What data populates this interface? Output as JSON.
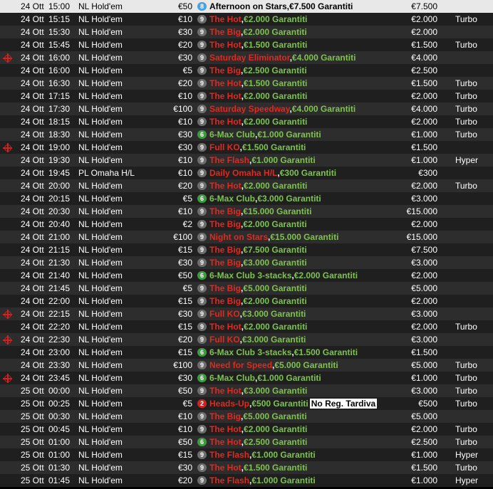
{
  "rows": [
    {
      "date": "24 Ott",
      "time": "15:00",
      "game": "NL Hold'em",
      "buyin": "€50",
      "badge": "8",
      "badge_color": "blue",
      "name_main": "Afternoon on Stars",
      "name_main_color": "black",
      "name_sep": ",",
      "name_rest": "€7.500 Garantiti",
      "name_rest_color": "black",
      "prize": "€7.500",
      "speed": "",
      "pk": false,
      "featured": true
    },
    {
      "date": "24 Ott",
      "time": "15:15",
      "game": "NL Hold'em",
      "buyin": "€10",
      "badge": "9",
      "badge_color": "gray",
      "name_main": "The Hot",
      "name_main_color": "red",
      "name_sep": ",",
      "name_rest": "€2.000 Garantiti",
      "name_rest_color": "green",
      "prize": "€2.000",
      "speed": "Turbo",
      "pk": false
    },
    {
      "date": "24 Ott",
      "time": "15:30",
      "game": "NL Hold'em",
      "buyin": "€30",
      "badge": "9",
      "badge_color": "gray",
      "name_main": "The Big",
      "name_main_color": "red",
      "name_sep": ",",
      "name_rest": "€2.000 Garantiti",
      "name_rest_color": "green",
      "prize": "€2.000",
      "speed": "",
      "pk": false
    },
    {
      "date": "24 Ott",
      "time": "15:45",
      "game": "NL Hold'em",
      "buyin": "€20",
      "badge": "9",
      "badge_color": "gray",
      "name_main": "The Hot",
      "name_main_color": "red",
      "name_sep": ",",
      "name_rest": "€1.500 Garantiti",
      "name_rest_color": "green",
      "prize": "€1.500",
      "speed": "Turbo",
      "pk": false
    },
    {
      "date": "24 Ott",
      "time": "16:00",
      "game": "NL Hold'em",
      "buyin": "€30",
      "badge": "9",
      "badge_color": "gray",
      "name_main": "Saturday Eliminator",
      "name_main_color": "red",
      "name_sep": ",",
      "name_rest": "€4.000 Garantiti",
      "name_rest_color": "green",
      "prize": "€4.000",
      "speed": "",
      "pk": true
    },
    {
      "date": "24 Ott",
      "time": "16:00",
      "game": "NL Hold'em",
      "buyin": "€5",
      "badge": "9",
      "badge_color": "gray",
      "name_main": "The Big",
      "name_main_color": "red",
      "name_sep": ",",
      "name_rest": "€2.500 Garantiti",
      "name_rest_color": "green",
      "prize": "€2.500",
      "speed": "",
      "pk": false
    },
    {
      "date": "24 Ott",
      "time": "16:30",
      "game": "NL Hold'em",
      "buyin": "€20",
      "badge": "9",
      "badge_color": "gray",
      "name_main": "The Hot",
      "name_main_color": "red",
      "name_sep": ",",
      "name_rest": "€1.500 Garantiti",
      "name_rest_color": "green",
      "prize": "€1.500",
      "speed": "Turbo",
      "pk": false
    },
    {
      "date": "24 Ott",
      "time": "17:15",
      "game": "NL Hold'em",
      "buyin": "€10",
      "badge": "9",
      "badge_color": "gray",
      "name_main": "The Hot",
      "name_main_color": "red",
      "name_sep": ",",
      "name_rest": "€2.000 Garantiti",
      "name_rest_color": "green",
      "prize": "€2.000",
      "speed": "Turbo",
      "pk": false
    },
    {
      "date": "24 Ott",
      "time": "17:30",
      "game": "NL Hold'em",
      "buyin": "€100",
      "badge": "9",
      "badge_color": "gray",
      "name_main": "Saturday Speedway",
      "name_main_color": "red",
      "name_sep": ",",
      "name_rest": "€4.000 Garantiti",
      "name_rest_color": "green",
      "prize": "€4.000",
      "speed": "Turbo",
      "pk": false
    },
    {
      "date": "24 Ott",
      "time": "18:15",
      "game": "NL Hold'em",
      "buyin": "€10",
      "badge": "9",
      "badge_color": "gray",
      "name_main": "The Hot",
      "name_main_color": "red",
      "name_sep": ",",
      "name_rest": "€2.000 Garantiti",
      "name_rest_color": "green",
      "prize": "€2.000",
      "speed": "Turbo",
      "pk": false
    },
    {
      "date": "24 Ott",
      "time": "18:30",
      "game": "NL Hold'em",
      "buyin": "€30",
      "badge": "6",
      "badge_color": "green",
      "name_main": "6-Max Club",
      "name_main_color": "green",
      "name_sep": ",",
      "name_rest": "€1.000 Garantiti",
      "name_rest_color": "green",
      "prize": "€1.000",
      "speed": "Turbo",
      "pk": false
    },
    {
      "date": "24 Ott",
      "time": "19:00",
      "game": "NL Hold'em",
      "buyin": "€30",
      "badge": "9",
      "badge_color": "gray",
      "name_main": "Full KO",
      "name_main_color": "red",
      "name_sep": ",",
      "name_rest": "€1.500 Garantiti",
      "name_rest_color": "green",
      "prize": "€1.500",
      "speed": "",
      "pk": true
    },
    {
      "date": "24 Ott",
      "time": "19:30",
      "game": "NL Hold'em",
      "buyin": "€10",
      "badge": "9",
      "badge_color": "gray",
      "name_main": "The Flash",
      "name_main_color": "red",
      "name_sep": ",",
      "name_rest": "€1.000 Garantiti",
      "name_rest_color": "green",
      "prize": "€1.000",
      "speed": "Hyper",
      "pk": false
    },
    {
      "date": "24 Ott",
      "time": "19:45",
      "game": "PL Omaha H/L",
      "buyin": "€10",
      "badge": "9",
      "badge_color": "gray",
      "name_main": "Daily Omaha H/L",
      "name_main_color": "red",
      "name_sep": ",",
      "name_rest": "€300 Garantiti",
      "name_rest_color": "green",
      "prize": "€300",
      "speed": "",
      "pk": false
    },
    {
      "date": "24 Ott",
      "time": "20:00",
      "game": "NL Hold'em",
      "buyin": "€20",
      "badge": "9",
      "badge_color": "gray",
      "name_main": "The Hot",
      "name_main_color": "red",
      "name_sep": ",",
      "name_rest": "€2.000 Garantiti",
      "name_rest_color": "green",
      "prize": "€2.000",
      "speed": "Turbo",
      "pk": false
    },
    {
      "date": "24 Ott",
      "time": "20:15",
      "game": "NL Hold'em",
      "buyin": "€5",
      "badge": "6",
      "badge_color": "green",
      "name_main": "6-Max Club",
      "name_main_color": "green",
      "name_sep": ",",
      "name_rest": "€3.000 Garantiti",
      "name_rest_color": "green",
      "prize": "€3.000",
      "speed": "",
      "pk": false
    },
    {
      "date": "24 Ott",
      "time": "20:30",
      "game": "NL Hold'em",
      "buyin": "€10",
      "badge": "9",
      "badge_color": "gray",
      "name_main": "The Big",
      "name_main_color": "red",
      "name_sep": ",",
      "name_rest": "€15.000 Garantiti",
      "name_rest_color": "green",
      "prize": "€15.000",
      "speed": "",
      "pk": false
    },
    {
      "date": "24 Ott",
      "time": "20:40",
      "game": "NL Hold'em",
      "buyin": "€2",
      "badge": "9",
      "badge_color": "gray",
      "name_main": "The Big",
      "name_main_color": "red",
      "name_sep": ",",
      "name_rest": "€2.000 Garantiti",
      "name_rest_color": "green",
      "prize": "€2.000",
      "speed": "",
      "pk": false
    },
    {
      "date": "24 Ott",
      "time": "21:00",
      "game": "NL Hold'em",
      "buyin": "€100",
      "badge": "9",
      "badge_color": "gray",
      "name_main": "Night on Stars",
      "name_main_color": "red",
      "name_sep": ",",
      "name_rest": "€15.000 Garantiti",
      "name_rest_color": "green",
      "prize": "€15.000",
      "speed": "",
      "pk": false
    },
    {
      "date": "24 Ott",
      "time": "21:15",
      "game": "NL Hold'em",
      "buyin": "€15",
      "badge": "9",
      "badge_color": "gray",
      "name_main": "The Big",
      "name_main_color": "red",
      "name_sep": ",",
      "name_rest": "€7.500 Garantiti",
      "name_rest_color": "green",
      "prize": "€7.500",
      "speed": "",
      "pk": false
    },
    {
      "date": "24 Ott",
      "time": "21:30",
      "game": "NL Hold'em",
      "buyin": "€30",
      "badge": "9",
      "badge_color": "gray",
      "name_main": "The Big",
      "name_main_color": "red",
      "name_sep": ",",
      "name_rest": "€3.000 Garantiti",
      "name_rest_color": "green",
      "prize": "€3.000",
      "speed": "",
      "pk": false
    },
    {
      "date": "24 Ott",
      "time": "21:40",
      "game": "NL Hold'em",
      "buyin": "€50",
      "badge": "6",
      "badge_color": "green",
      "name_main": "6-Max Club 3-stacks",
      "name_main_color": "green",
      "name_sep": ",",
      "name_rest": "€2.000 Garantiti",
      "name_rest_color": "green",
      "prize": "€2.000",
      "speed": "",
      "pk": false
    },
    {
      "date": "24 Ott",
      "time": "21:45",
      "game": "NL Hold'em",
      "buyin": "€5",
      "badge": "9",
      "badge_color": "gray",
      "name_main": "The Big",
      "name_main_color": "red",
      "name_sep": ",",
      "name_rest": "€5.000 Garantiti",
      "name_rest_color": "green",
      "prize": "€5.000",
      "speed": "",
      "pk": false
    },
    {
      "date": "24 Ott",
      "time": "22:00",
      "game": "NL Hold'em",
      "buyin": "€15",
      "badge": "9",
      "badge_color": "gray",
      "name_main": "The Big",
      "name_main_color": "red",
      "name_sep": ",",
      "name_rest": "€2.000 Garantiti",
      "name_rest_color": "green",
      "prize": "€2.000",
      "speed": "",
      "pk": false
    },
    {
      "date": "24 Ott",
      "time": "22:15",
      "game": "NL Hold'em",
      "buyin": "€30",
      "badge": "9",
      "badge_color": "gray",
      "name_main": "Full KO",
      "name_main_color": "red",
      "name_sep": ",",
      "name_rest": "€3.000 Garantiti",
      "name_rest_color": "green",
      "prize": "€3.000",
      "speed": "",
      "pk": true
    },
    {
      "date": "24 Ott",
      "time": "22:20",
      "game": "NL Hold'em",
      "buyin": "€15",
      "badge": "9",
      "badge_color": "gray",
      "name_main": "The Hot",
      "name_main_color": "red",
      "name_sep": ",",
      "name_rest": "€2.000 Garantiti",
      "name_rest_color": "green",
      "prize": "€2.000",
      "speed": "Turbo",
      "pk": false
    },
    {
      "date": "24 Ott",
      "time": "22:30",
      "game": "NL Hold'em",
      "buyin": "€20",
      "badge": "9",
      "badge_color": "gray",
      "name_main": "Full KO",
      "name_main_color": "red",
      "name_sep": ",",
      "name_rest": "€3.000 Garantiti",
      "name_rest_color": "green",
      "prize": "€3.000",
      "speed": "",
      "pk": true
    },
    {
      "date": "24 Ott",
      "time": "23:00",
      "game": "NL Hold'em",
      "buyin": "€15",
      "badge": "6",
      "badge_color": "green",
      "name_main": "6-Max Club 3-stacks",
      "name_main_color": "green",
      "name_sep": ",",
      "name_rest": "€1.500 Garantiti",
      "name_rest_color": "green",
      "prize": "€1.500",
      "speed": "",
      "pk": false
    },
    {
      "date": "24 Ott",
      "time": "23:30",
      "game": "NL Hold'em",
      "buyin": "€100",
      "badge": "9",
      "badge_color": "gray",
      "name_main": "Need for Speed",
      "name_main_color": "red",
      "name_sep": ",",
      "name_rest": "€5.000 Garantiti",
      "name_rest_color": "green",
      "prize": "€5.000",
      "speed": "Turbo",
      "pk": false
    },
    {
      "date": "24 Ott",
      "time": "23:45",
      "game": "NL Hold'em",
      "buyin": "€30",
      "badge": "6",
      "badge_color": "green",
      "name_main": "6-Max Club",
      "name_main_color": "green",
      "name_sep": ",",
      "name_rest": "€1.000 Garantiti",
      "name_rest_color": "green",
      "prize": "€1.000",
      "speed": "Turbo",
      "pk": true
    },
    {
      "date": "25 Ott",
      "time": "00:00",
      "game": "NL Hold'em",
      "buyin": "€50",
      "badge": "9",
      "badge_color": "gray",
      "name_main": "The Hot",
      "name_main_color": "red",
      "name_sep": ",",
      "name_rest": "€3.000 Garantiti",
      "name_rest_color": "green",
      "prize": "€3.000",
      "speed": "Turbo",
      "pk": false
    },
    {
      "date": "25 Ott",
      "time": "00:25",
      "game": "NL Hold'em",
      "buyin": "€5",
      "badge": "2",
      "badge_color": "red",
      "name_main": "Heads-Up",
      "name_main_color": "red",
      "name_sep": ",",
      "name_rest": "€500 Garantiti",
      "name_rest_color": "green",
      "extra": "No Reg. Tardiva",
      "prize": "€500",
      "speed": "Turbo",
      "pk": false
    },
    {
      "date": "25 Ott",
      "time": "00:30",
      "game": "NL Hold'em",
      "buyin": "€10",
      "badge": "9",
      "badge_color": "gray",
      "name_main": "The Big",
      "name_main_color": "red",
      "name_sep": ",",
      "name_rest": "€5.000 Garantiti",
      "name_rest_color": "green",
      "prize": "€5.000",
      "speed": "",
      "pk": false
    },
    {
      "date": "25 Ott",
      "time": "00:45",
      "game": "NL Hold'em",
      "buyin": "€10",
      "badge": "9",
      "badge_color": "gray",
      "name_main": "The Hot",
      "name_main_color": "red",
      "name_sep": ",",
      "name_rest": "€2.000 Garantiti",
      "name_rest_color": "green",
      "prize": "€2.000",
      "speed": "Turbo",
      "pk": false
    },
    {
      "date": "25 Ott",
      "time": "01:00",
      "game": "NL Hold'em",
      "buyin": "€50",
      "badge": "6",
      "badge_color": "green",
      "name_main": "The Hot",
      "name_main_color": "red",
      "name_sep": ",",
      "name_rest": "€2.500 Garantiti",
      "name_rest_color": "green",
      "prize": "€2.500",
      "speed": "Turbo",
      "pk": false
    },
    {
      "date": "25 Ott",
      "time": "01:00",
      "game": "NL Hold'em",
      "buyin": "€15",
      "badge": "9",
      "badge_color": "gray",
      "name_main": "The Flash",
      "name_main_color": "red",
      "name_sep": ",",
      "name_rest": "€1.000 Garantiti",
      "name_rest_color": "green",
      "prize": "€1.000",
      "speed": "Hyper",
      "pk": false
    },
    {
      "date": "25 Ott",
      "time": "01:30",
      "game": "NL Hold'em",
      "buyin": "€30",
      "badge": "9",
      "badge_color": "gray",
      "name_main": "The Hot",
      "name_main_color": "red",
      "name_sep": ",",
      "name_rest": "€1.500 Garantiti",
      "name_rest_color": "green",
      "prize": "€1.500",
      "speed": "Turbo",
      "pk": false
    },
    {
      "date": "25 Ott",
      "time": "01:45",
      "game": "NL Hold'em",
      "buyin": "€20",
      "badge": "9",
      "badge_color": "gray",
      "name_main": "The Flash",
      "name_main_color": "red",
      "name_sep": ",",
      "name_rest": "€1.000 Garantiti",
      "name_rest_color": "green",
      "prize": "€1.000",
      "speed": "Hyper",
      "pk": false
    }
  ]
}
